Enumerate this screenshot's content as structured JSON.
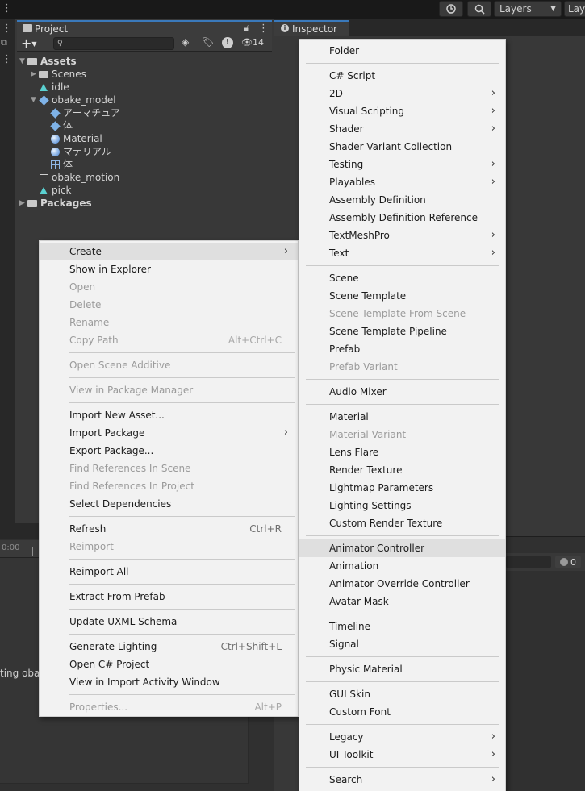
{
  "toolbar": {
    "history_icon": "history-icon",
    "search_icon": "search-icon",
    "layers_label": "Layers",
    "layout_label": "Lay"
  },
  "project_panel": {
    "tab_label": "Project",
    "visibility_count": "14",
    "search_icon": "magnifier-icon",
    "tree": [
      {
        "label": "Assets",
        "depth": 0,
        "icon": "folder-open-icon",
        "expanded": true,
        "bold": true
      },
      {
        "label": "Scenes",
        "depth": 1,
        "icon": "folder-icon",
        "collapsed": true
      },
      {
        "label": "idle",
        "depth": 1,
        "icon": "animation-clip-icon"
      },
      {
        "label": "obake_model",
        "depth": 1,
        "icon": "model-prefab-icon",
        "expanded": true
      },
      {
        "label": "アーマチュア",
        "depth": 2,
        "icon": "model-prefab-icon"
      },
      {
        "label": "体",
        "depth": 2,
        "icon": "model-prefab-icon"
      },
      {
        "label": "Material",
        "depth": 2,
        "icon": "material-icon"
      },
      {
        "label": "マテリアル",
        "depth": 2,
        "icon": "material-icon"
      },
      {
        "label": "体",
        "depth": 2,
        "icon": "mesh-grid-icon"
      },
      {
        "label": "obake_motion",
        "depth": 1,
        "icon": "animator-controller-icon"
      },
      {
        "label": "pick",
        "depth": 1,
        "icon": "animation-clip-icon"
      },
      {
        "label": "Packages",
        "depth": 0,
        "icon": "folder-icon",
        "collapsed": true,
        "bold": true
      }
    ]
  },
  "inspector": {
    "tab_label": "Inspector"
  },
  "bottom": {
    "ruler_label": "0:00",
    "status_text": "ting obak",
    "count": "0"
  },
  "main_menu": {
    "groups": [
      [
        {
          "label": "Create",
          "submenu": true,
          "highlighted": true
        },
        {
          "label": "Show in Explorer"
        },
        {
          "label": "Open",
          "disabled": true
        },
        {
          "label": "Delete",
          "disabled": true
        },
        {
          "label": "Rename",
          "disabled": true
        },
        {
          "label": "Copy Path",
          "shortcut": "Alt+Ctrl+C",
          "disabled": true
        }
      ],
      [
        {
          "label": "Open Scene Additive",
          "disabled": true
        }
      ],
      [
        {
          "label": "View in Package Manager",
          "disabled": true
        }
      ],
      [
        {
          "label": "Import New Asset..."
        },
        {
          "label": "Import Package",
          "submenu": true
        },
        {
          "label": "Export Package..."
        },
        {
          "label": "Find References In Scene",
          "disabled": true
        },
        {
          "label": "Find References In Project",
          "disabled": true
        },
        {
          "label": "Select Dependencies"
        }
      ],
      [
        {
          "label": "Refresh",
          "shortcut": "Ctrl+R"
        },
        {
          "label": "Reimport",
          "disabled": true
        }
      ],
      [
        {
          "label": "Reimport All"
        }
      ],
      [
        {
          "label": "Extract From Prefab"
        }
      ],
      [
        {
          "label": "Update UXML Schema"
        }
      ],
      [
        {
          "label": "Generate Lighting",
          "shortcut": "Ctrl+Shift+L"
        },
        {
          "label": "Open C# Project"
        },
        {
          "label": "View in Import Activity Window"
        }
      ],
      [
        {
          "label": "Properties...",
          "shortcut": "Alt+P",
          "disabled": true
        }
      ]
    ]
  },
  "create_menu": {
    "groups": [
      [
        {
          "label": "Folder"
        }
      ],
      [
        {
          "label": "C# Script"
        },
        {
          "label": "2D",
          "submenu": true
        },
        {
          "label": "Visual Scripting",
          "submenu": true
        },
        {
          "label": "Shader",
          "submenu": true
        },
        {
          "label": "Shader Variant Collection"
        },
        {
          "label": "Testing",
          "submenu": true
        },
        {
          "label": "Playables",
          "submenu": true
        },
        {
          "label": "Assembly Definition"
        },
        {
          "label": "Assembly Definition Reference"
        },
        {
          "label": "TextMeshPro",
          "submenu": true
        },
        {
          "label": "Text",
          "submenu": true
        }
      ],
      [
        {
          "label": "Scene"
        },
        {
          "label": "Scene Template"
        },
        {
          "label": "Scene Template From Scene",
          "disabled": true
        },
        {
          "label": "Scene Template Pipeline"
        },
        {
          "label": "Prefab"
        },
        {
          "label": "Prefab Variant",
          "disabled": true
        }
      ],
      [
        {
          "label": "Audio Mixer"
        }
      ],
      [
        {
          "label": "Material"
        },
        {
          "label": "Material Variant",
          "disabled": true
        },
        {
          "label": "Lens Flare"
        },
        {
          "label": "Render Texture"
        },
        {
          "label": "Lightmap Parameters"
        },
        {
          "label": "Lighting Settings"
        },
        {
          "label": "Custom Render Texture"
        }
      ],
      [
        {
          "label": "Animator Controller",
          "highlighted": true
        },
        {
          "label": "Animation"
        },
        {
          "label": "Animator Override Controller"
        },
        {
          "label": "Avatar Mask"
        }
      ],
      [
        {
          "label": "Timeline"
        },
        {
          "label": "Signal"
        }
      ],
      [
        {
          "label": "Physic Material"
        }
      ],
      [
        {
          "label": "GUI Skin"
        },
        {
          "label": "Custom Font"
        }
      ],
      [
        {
          "label": "Legacy",
          "submenu": true
        },
        {
          "label": "UI Toolkit",
          "submenu": true
        }
      ],
      [
        {
          "label": "Search",
          "submenu": true
        }
      ]
    ]
  },
  "colors": {
    "editor_bg": "#383838",
    "menu_bg": "#f2f2f2",
    "menu_highlight": "#dfdfdf",
    "accent_tab": "#3a79bb",
    "disabled_text": "#9b9b9b"
  }
}
